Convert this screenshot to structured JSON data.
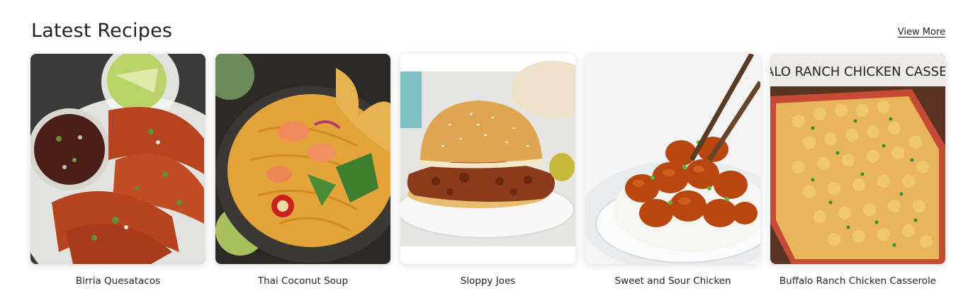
{
  "section": {
    "title": "Latest Recipes",
    "view_more": "View More"
  },
  "recipes": [
    {
      "title": "Birria Quesatacos",
      "image": "birria-quesatacos-photo"
    },
    {
      "title": "Thai Coconut Soup",
      "image": "thai-coconut-soup-photo"
    },
    {
      "title": "Sloppy Joes",
      "image": "sloppy-joes-photo"
    },
    {
      "title": "Sweet and Sour Chicken",
      "image": "sweet-and-sour-chicken-photo"
    },
    {
      "title": "Buffalo Ranch Chicken Casserole",
      "image": "buffalo-ranch-chicken-casserole-photo",
      "image_text": "BUFFALO RANCH CHICKEN CASSEROLE"
    }
  ]
}
